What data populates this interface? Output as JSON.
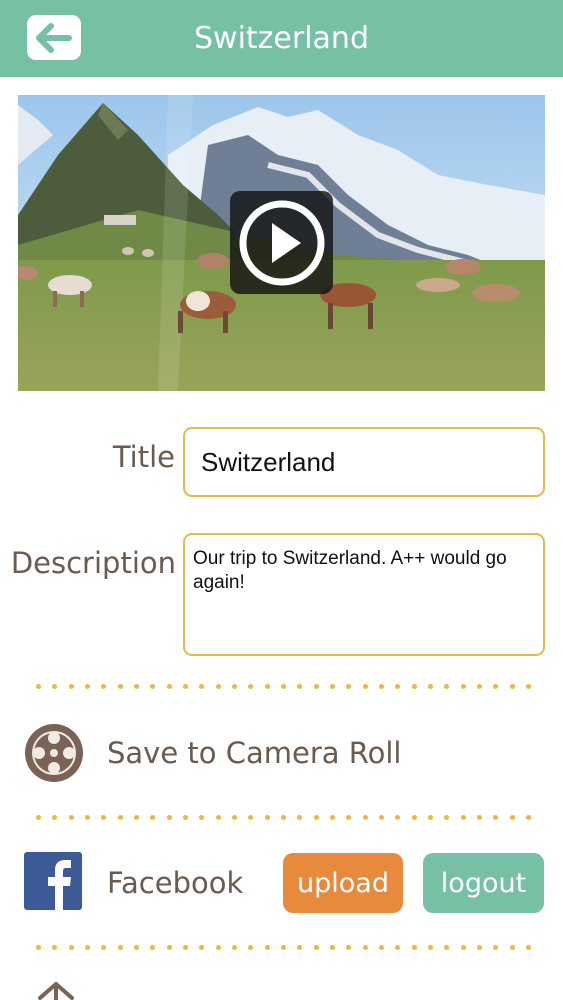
{
  "header": {
    "title": "Switzerland",
    "back_icon": "back-arrow-icon",
    "background": "#76c0a4"
  },
  "video": {
    "play_icon": "play-icon"
  },
  "form": {
    "title_label": "Title",
    "title_value": "Switzerland",
    "description_label": "Description",
    "description_value": "Our trip to Switzerland. A++ would go again!",
    "field_border": "#e6b84e"
  },
  "actions": {
    "camera_roll": {
      "label": "Save to Camera Roll",
      "icon": "film-reel-icon"
    },
    "facebook": {
      "label": "Facebook",
      "icon": "facebook-icon",
      "upload_label": "upload",
      "logout_label": "logout",
      "upload_color": "#e88a3c",
      "logout_color": "#76c0a4"
    },
    "next_icon": "share-icon"
  },
  "divider_color": "#f0b63e"
}
